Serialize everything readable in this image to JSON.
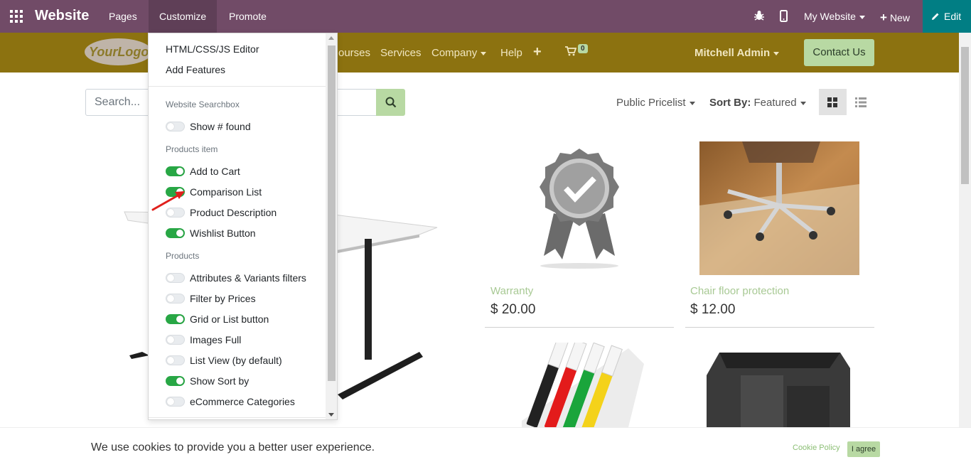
{
  "topbar": {
    "brand": "Website",
    "menus": [
      "Pages",
      "Customize",
      "Promote"
    ],
    "my_website": "My Website",
    "new_label": "New",
    "edit_label": "Edit"
  },
  "header": {
    "logo_text": "YourLogo",
    "nav": [
      "ourses",
      "Services",
      "Company",
      "Help"
    ],
    "cart_count": "0",
    "user": "Mitchell Admin",
    "contact": "Contact Us"
  },
  "shop": {
    "search_placeholder": "Search...",
    "pricelist": "Public Pricelist",
    "sort_label": "Sort By:",
    "sort_value": "Featured",
    "products": [
      {
        "name": "Warranty",
        "price": "$ 20.00"
      },
      {
        "name": "Chair floor protection",
        "price": "$ 12.00"
      }
    ]
  },
  "customize": {
    "items": [
      "HTML/CSS/JS Editor",
      "Add Features"
    ],
    "sections": [
      {
        "header": "Website Searchbox",
        "options": [
          {
            "label": "Show # found",
            "on": false
          }
        ]
      },
      {
        "header": "Products item",
        "options": [
          {
            "label": "Add to Cart",
            "on": true
          },
          {
            "label": "Comparison List",
            "on": true
          },
          {
            "label": "Product Description",
            "on": false
          },
          {
            "label": "Wishlist Button",
            "on": true
          }
        ]
      },
      {
        "header": "Products",
        "options": [
          {
            "label": "Attributes & Variants filters",
            "on": false
          },
          {
            "label": "Filter by Prices",
            "on": false
          },
          {
            "label": "Grid or List button",
            "on": true
          },
          {
            "label": "Images Full",
            "on": false
          },
          {
            "label": "List View (by default)",
            "on": false
          },
          {
            "label": "Show Sort by",
            "on": true
          },
          {
            "label": "eCommerce Categories",
            "on": false
          }
        ]
      }
    ]
  },
  "cookie": {
    "message": "We use cookies to provide you a better user experience.",
    "policy": "Cookie Policy",
    "agree": "I agree"
  },
  "colors": {
    "admin_bar": "#714b67",
    "header": "#8c7210",
    "edit": "#017e84",
    "accent": "#b8d9a3",
    "toggle_on": "#28a745"
  }
}
